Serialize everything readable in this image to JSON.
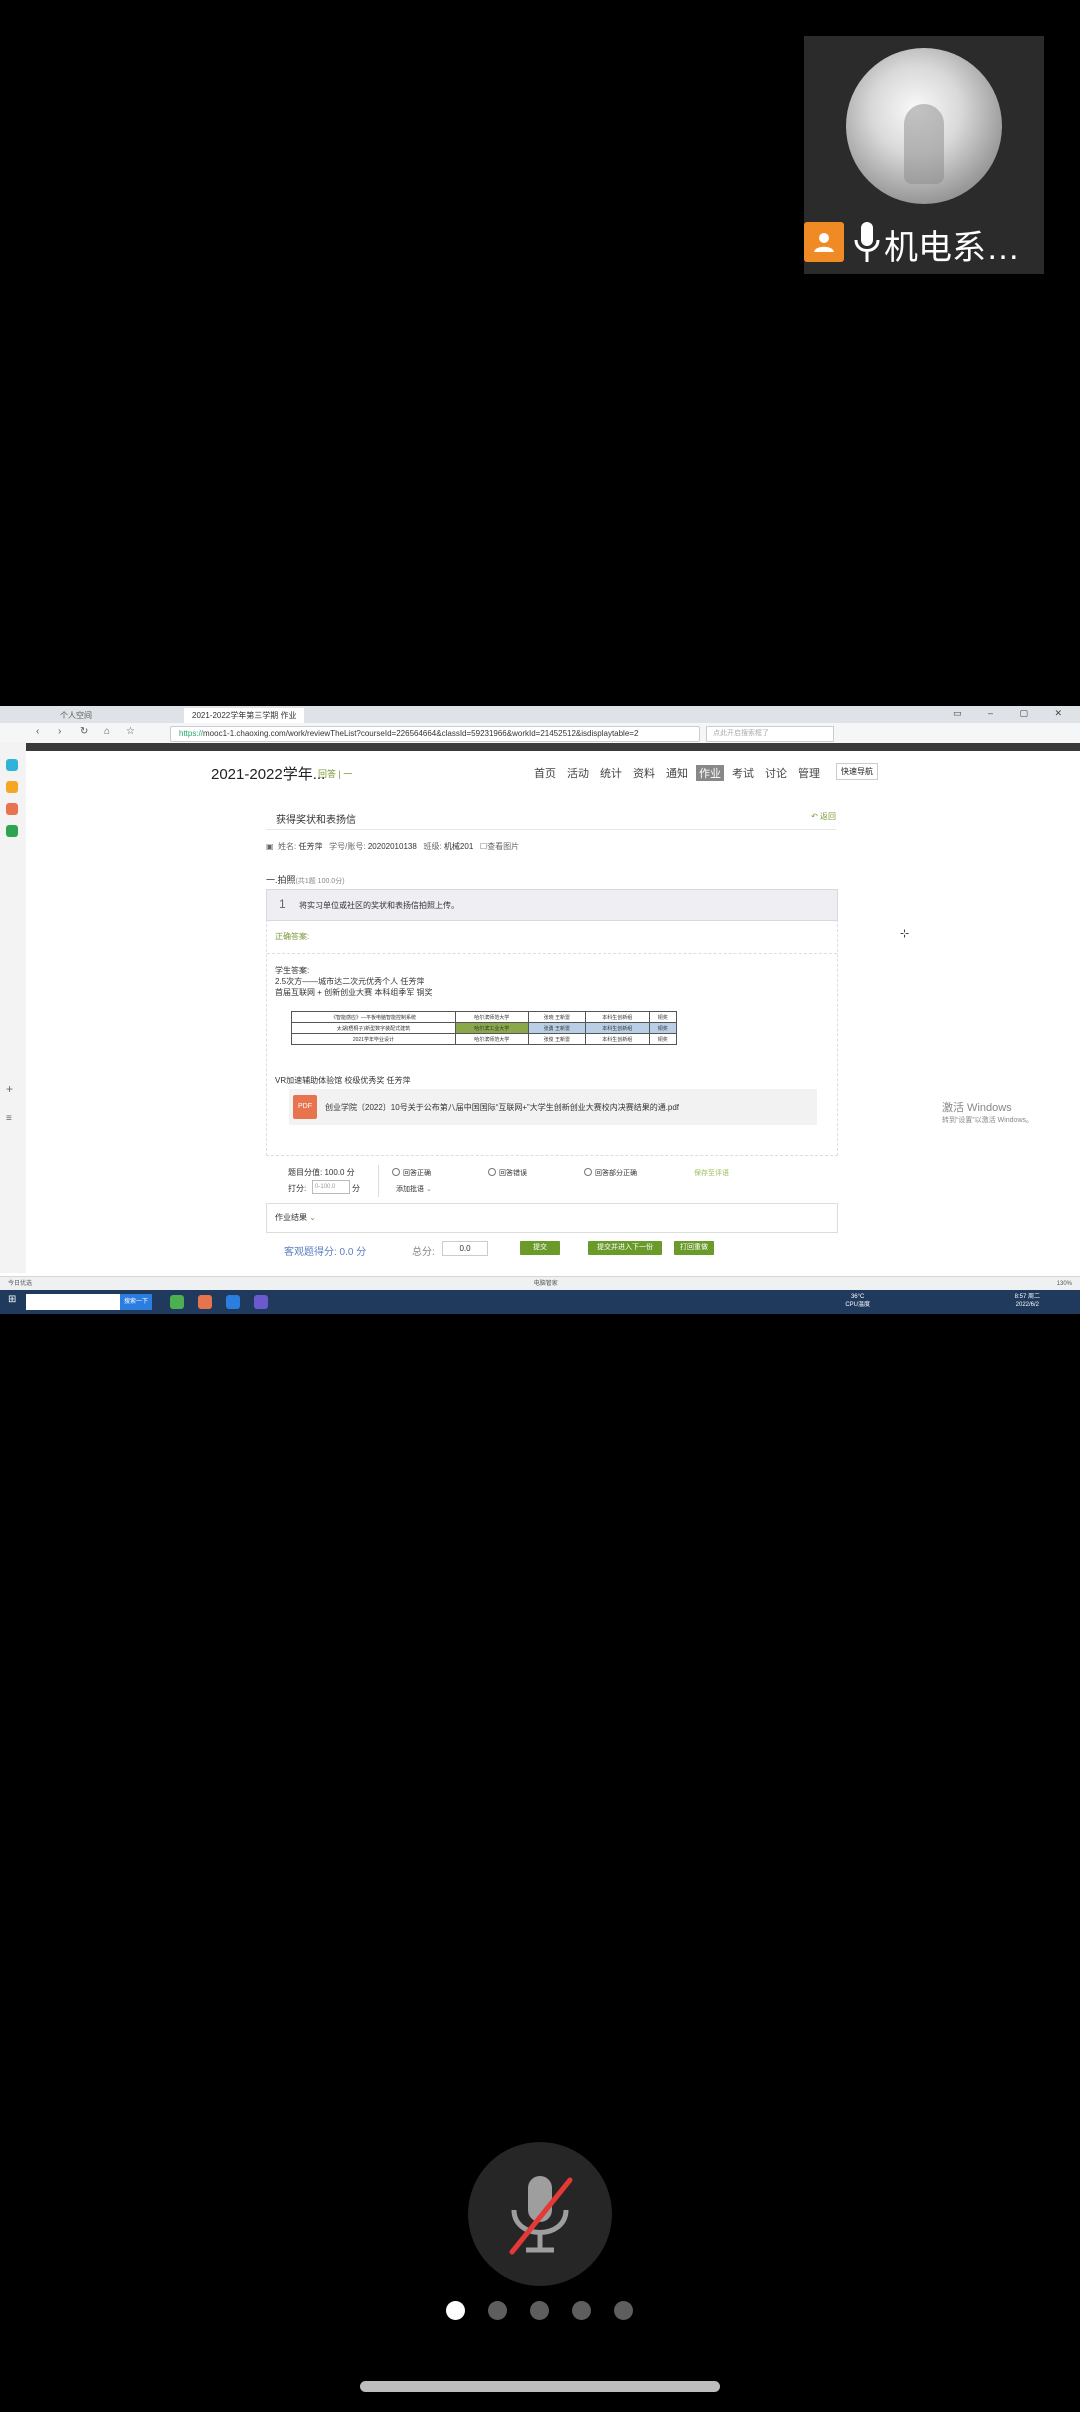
{
  "participant": {
    "name": "机电系…"
  },
  "browser": {
    "tabs": [
      "个人空间",
      "2021-2022学年第三学期 作业"
    ],
    "url_secure": "https://",
    "url_rest": "mooc1-1.chaoxing.com/work/reviewTheList?courseId=226564664&classId=59231966&workId=21452512&isdisplaytable=2",
    "search_placeholder": "点此开启搜索框了"
  },
  "page": {
    "course_title": "2021-2022学年...",
    "course_sub": "回答 | 一",
    "menu": [
      "首页",
      "活动",
      "统计",
      "资料",
      "通知",
      "作业",
      "考试",
      "讨论",
      "管理"
    ],
    "active_menu": "作业",
    "fast_nav": "快速导航",
    "homework_title": "获得奖状和表扬信",
    "back": "返回",
    "student": {
      "name_label": "姓名:",
      "name": "任芳萍",
      "id_label": "学号/账号:",
      "id": "20202010138",
      "class_label": "班级:",
      "class": "机械201",
      "preview": "查看图片"
    },
    "section": "一.拍照",
    "section_note": "(共1题 100.0分)",
    "question_num": "1",
    "question_text": "将实习单位或社区的奖状和表扬信拍照上传。",
    "correct_label": "正确答案:",
    "student_answer_label": "学生答案:",
    "answer_lines": [
      "2.5次方——城市达二次元优秀个人 任芳萍",
      "首届互联网 + 创新创业大赛 本科组季军 铜奖"
    ],
    "table_rows": [
      [
        "《智能感应》—平板电脑智能控制系统",
        "哈尔滨师范大学",
        "张晓 王新雷",
        "本科生创新组",
        "铜奖"
      ],
      [
        "太湖(梧桐子)新型数字装配式建筑",
        "哈尔滨工业大学",
        "张勇 王新雷",
        "本科生创新组",
        "铜奖"
      ],
      [
        "2021学年毕业设计",
        "哈尔滨师范大学",
        "张俊 王新雷",
        "本科生创新组",
        "铜奖"
      ]
    ],
    "vr_line": "VR加速辅助体验馆 校级优秀奖 任芳萍",
    "attachment": {
      "type": "PDF",
      "name": "创业学院〔2022〕10号关于公布第八届中国国际“互联网+”大学生创新创业大赛校内决赛结果的通.pdf"
    },
    "question_score": "题目分值: 100.0 分",
    "grade_label": "打分:",
    "grade_placeholder": "0-100.0",
    "grade_unit": "分",
    "radios": [
      "回答正确",
      "回答错误",
      "回答部分正确"
    ],
    "add_comment": "添加批语",
    "save_comment": "保存至评语",
    "hw_result": "作业结果",
    "mc_score_label": "客观题得分: 0.0 分",
    "total_label": "总分:",
    "total_value": "0.0",
    "buttons": {
      "submit": "提交",
      "submit_next": "提交并进入下一份",
      "return": "打回重做"
    },
    "activate": {
      "title": "激活 Windows",
      "sub": "转到“设置”以激活 Windows。"
    }
  },
  "statusbar": {
    "left": "今日优选",
    "mid": "电脑管家",
    "zoom": "130%"
  },
  "taskbar": {
    "search_button": "搜索一下",
    "weather": [
      "36°C",
      "CPU温度"
    ],
    "time": [
      "8:57 周二",
      "2022/6/2"
    ]
  },
  "pager": {
    "count": 5,
    "active": 0
  }
}
